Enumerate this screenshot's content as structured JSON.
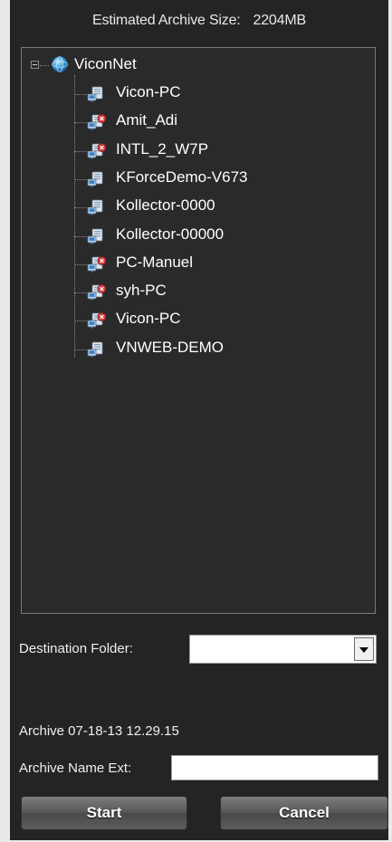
{
  "header": {
    "estimated_label": "Estimated Archive Size:",
    "estimated_value": "2204MB"
  },
  "tree": {
    "root": {
      "label": "ViconNet",
      "icon": "globe-network-icon",
      "expanded": true
    },
    "nodes": [
      {
        "label": "Vicon-PC",
        "icon": "server-online-icon",
        "status": "online"
      },
      {
        "label": "Amit_Adi",
        "icon": "server-offline-icon",
        "status": "offline"
      },
      {
        "label": "INTL_2_W7P",
        "icon": "server-offline-icon",
        "status": "offline"
      },
      {
        "label": "KForceDemo-V673",
        "icon": "server-online-icon",
        "status": "online"
      },
      {
        "label": "Kollector-0000",
        "icon": "server-online-icon",
        "status": "online"
      },
      {
        "label": "Kollector-00000",
        "icon": "server-online-icon",
        "status": "online"
      },
      {
        "label": "PC-Manuel",
        "icon": "server-offline-icon",
        "status": "offline"
      },
      {
        "label": "syh-PC",
        "icon": "server-offline-icon",
        "status": "offline"
      },
      {
        "label": "Vicon-PC",
        "icon": "server-offline-icon",
        "status": "offline"
      },
      {
        "label": "VNWEB-DEMO",
        "icon": "server-online-icon",
        "status": "online"
      }
    ]
  },
  "destination": {
    "label": "Destination Folder:",
    "value": ""
  },
  "archive": {
    "name": "Archive 07-18-13 12.29.15",
    "ext_label": "Archive Name Ext:",
    "ext_value": ""
  },
  "buttons": {
    "start": "Start",
    "cancel": "Cancel"
  },
  "colors": {
    "panel_bg": "#242424",
    "tree_bg": "#2a2a2a",
    "offline_badge": "#d33a3a",
    "text": "#ffffff"
  }
}
